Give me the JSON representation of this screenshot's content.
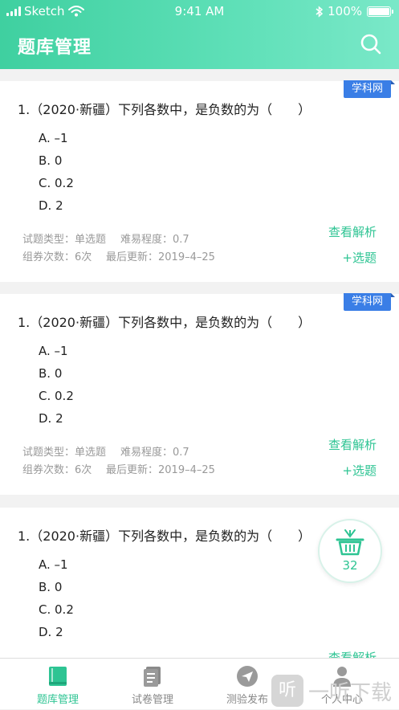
{
  "status": {
    "carrier": "Sketch",
    "time": "9:41 AM",
    "battery": "100%"
  },
  "header": {
    "title": "题库管理"
  },
  "colors": {
    "accent": "#2ec493",
    "badge": "#3a7ee6"
  },
  "questions": [
    {
      "badge": "学科网",
      "text": "1.（2020·新疆）下列各数中，是负数的为（　　）",
      "options": [
        "A. –1",
        "B. 0",
        "C. 0.2",
        "D. 2"
      ],
      "type_text": "试题类型：单选题",
      "difficulty_text": "难易程度：0.7",
      "count_text": "组券次数：6次",
      "updated_text": "最后更新：2019–4–25",
      "view_label": "查看解析",
      "select_label": "+选题"
    },
    {
      "badge": "学科网",
      "text": "1.（2020·新疆）下列各数中，是负数的为（　　）",
      "options": [
        "A. –1",
        "B. 0",
        "C. 0.2",
        "D. 2"
      ],
      "type_text": "试题类型：单选题",
      "difficulty_text": "难易程度：0.7",
      "count_text": "组券次数：6次",
      "updated_text": "最后更新：2019–4–25",
      "view_label": "查看解析",
      "select_label": "+选题"
    },
    {
      "text": "1.（2020·新疆）下列各数中，是负数的为（　　）",
      "options": [
        "A. –1",
        "B. 0",
        "C. 0.2",
        "D. 2"
      ],
      "view_label": "查看解析"
    }
  ],
  "basket": {
    "count": "32",
    "icon": "basket-icon"
  },
  "tabs": [
    {
      "label": "题库管理",
      "icon": "book-icon",
      "active": true
    },
    {
      "label": "试卷管理",
      "icon": "paper-icon",
      "active": false
    },
    {
      "label": "测验发布",
      "icon": "send-icon",
      "active": false
    },
    {
      "label": "个人中心",
      "icon": "user-icon",
      "active": false
    }
  ],
  "watermark": {
    "glyph": "听",
    "text": "一听下载"
  }
}
